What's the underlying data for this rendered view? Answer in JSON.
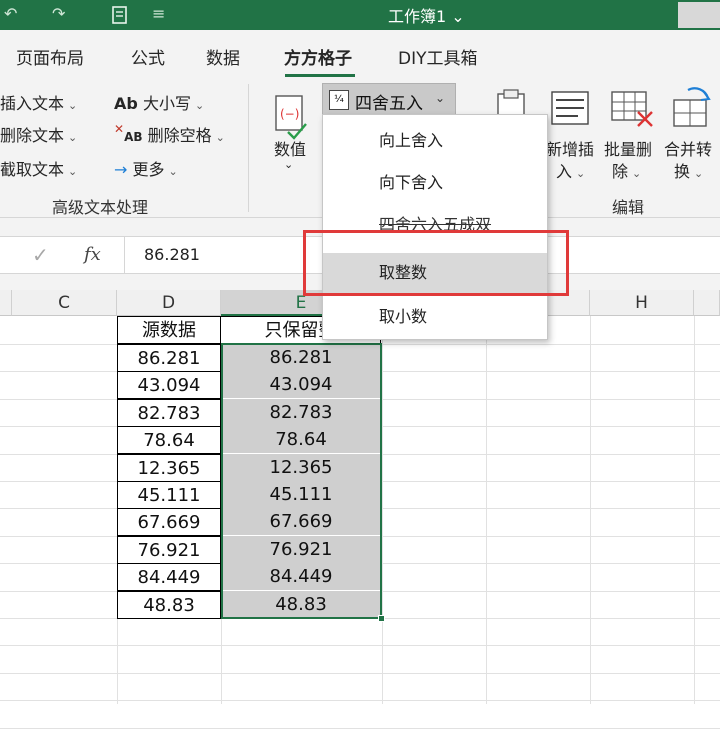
{
  "titlebar": {
    "title": "工作簿1 ⌄",
    "undo_glyph": "↶",
    "redo_glyph": "↷",
    "quick_glyph": "≡"
  },
  "tabs": [
    {
      "label": "页面布局",
      "active": false
    },
    {
      "label": "公式",
      "active": false
    },
    {
      "label": "数据",
      "active": false
    },
    {
      "label": "方方格子",
      "active": true
    },
    {
      "label": "DIY工具箱",
      "active": false
    }
  ],
  "ribbon": {
    "text_group": {
      "insert_text": "插入文本",
      "delete_text": "删除文本",
      "extract_text": "截取文本",
      "case": "大小写",
      "case_icon_text": "Ab",
      "delete_spaces": "删除空格",
      "delete_spaces_icon_text": "AB",
      "more": "更多",
      "more_icon_glyph": "→",
      "group_label": "高级文本处理"
    },
    "value_button": "数值",
    "round_button": "四舍五入",
    "edit_group": {
      "new_insert": [
        "新增插",
        "入"
      ],
      "batch_delete": [
        "批量删",
        "除"
      ],
      "merge_convert": [
        "合并转",
        "换"
      ],
      "group_label": "编辑"
    },
    "chevron": "⌄"
  },
  "formula_bar": {
    "check_glyph": "✓",
    "fx_label": "fx",
    "value": "86.281"
  },
  "sheet": {
    "columns": [
      "C",
      "D",
      "E",
      "H"
    ],
    "header_d": "源数据",
    "header_e": "只保留整",
    "source_values": [
      "86.281",
      "43.094",
      "82.783",
      "78.64",
      "12.365",
      "45.111",
      "67.669",
      "76.921",
      "84.449",
      "48.83"
    ],
    "result_values": [
      "86.281",
      "43.094",
      "82.783",
      "78.64",
      "12.365",
      "45.111",
      "67.669",
      "76.921",
      "84.449",
      "48.83"
    ]
  },
  "dropdown": {
    "items": [
      "向上舍入",
      "向下舍入",
      "四舍六入五成双",
      "取整数",
      "取小数"
    ],
    "hovered_index": 3
  },
  "colors": {
    "excel_green": "#217346",
    "highlight_red": "#e03a3a"
  }
}
